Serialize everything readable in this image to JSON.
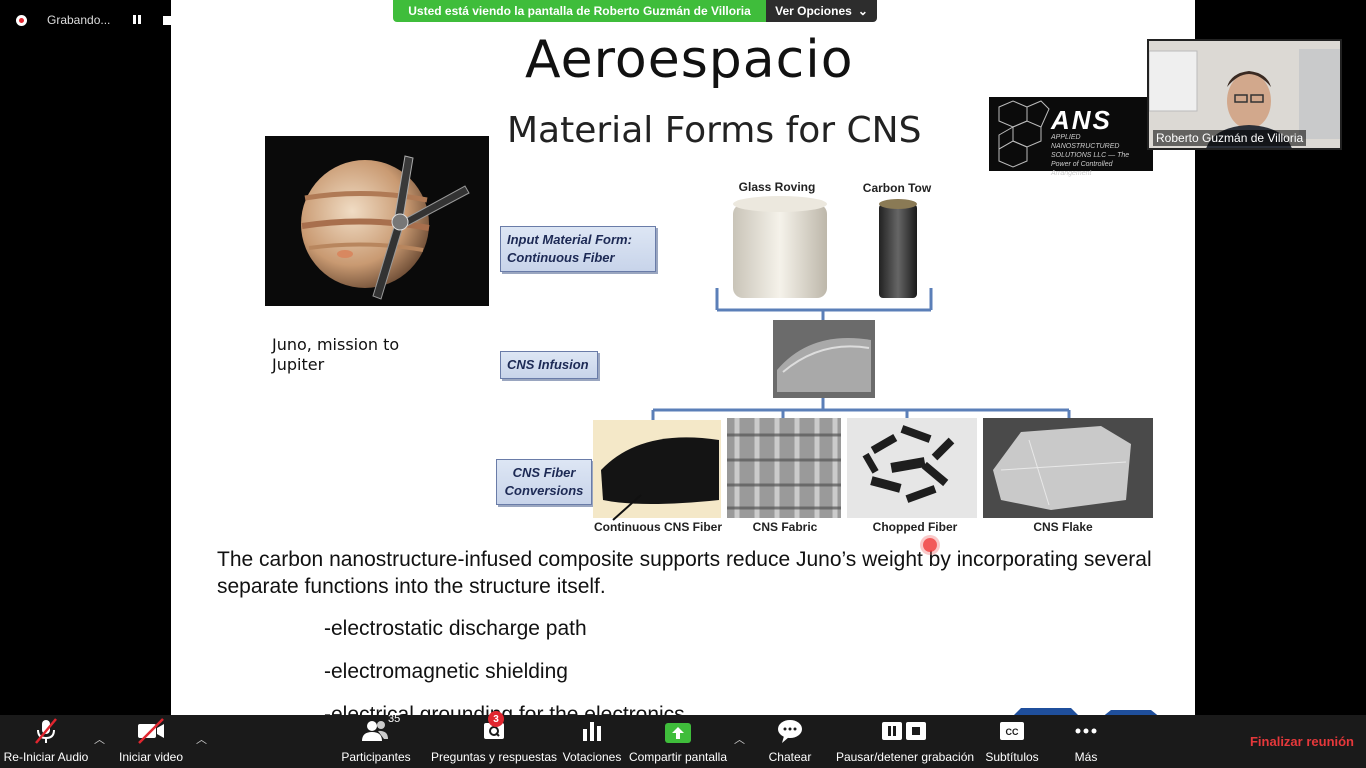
{
  "recording": {
    "label": "Grabando..."
  },
  "share_banner": {
    "message": "Usted está viendo la pantalla de Roberto Guzmán de Villoria",
    "options_label": "Ver Opciones"
  },
  "video": {
    "participant_name": "Roberto Guzmán de Villoria"
  },
  "slide": {
    "title": "Aeroespacio",
    "subtitle": "Material Forms for CNS",
    "juno_caption": "Juno, mission to Jupiter",
    "boxes": {
      "input_material": "Input Material Form: Continuous Fiber",
      "infusion": "CNS Infusion",
      "conversions": "CNS Fiber Conversions"
    },
    "materials": {
      "glass_roving": "Glass Roving",
      "carbon_tow": "Carbon Tow",
      "continuous_fiber": "Continuous CNS Fiber",
      "fabric": "CNS Fabric",
      "chopped": "Chopped Fiber",
      "flake": "CNS Flake"
    },
    "logo": {
      "name": "ANS",
      "tagline": "APPLIED NANOSTRUCTURED SOLUTIONS LLC — The Power of Controlled Arrangement"
    },
    "body": "The carbon nanostructure-infused composite supports reduce Juno’s weight by incorporating several separate functions into the structure itself.",
    "bullets": [
      "-electrostatic discharge path",
      "-electromagnetic shielding",
      "-electrical grounding for the electronics"
    ]
  },
  "toolbar": {
    "audio": "Re-Iniciar Audio",
    "video": "Iniciar video",
    "participants": "Participantes",
    "participants_count": "35",
    "qa": "Preguntas y respuestas",
    "qa_badge": "3",
    "polls": "Votaciones",
    "share": "Compartir pantalla",
    "chat": "Chatear",
    "record": "Pausar/detener grabación",
    "captions": "Subtítulos",
    "more": "Más",
    "end": "Finalizar reunión"
  }
}
